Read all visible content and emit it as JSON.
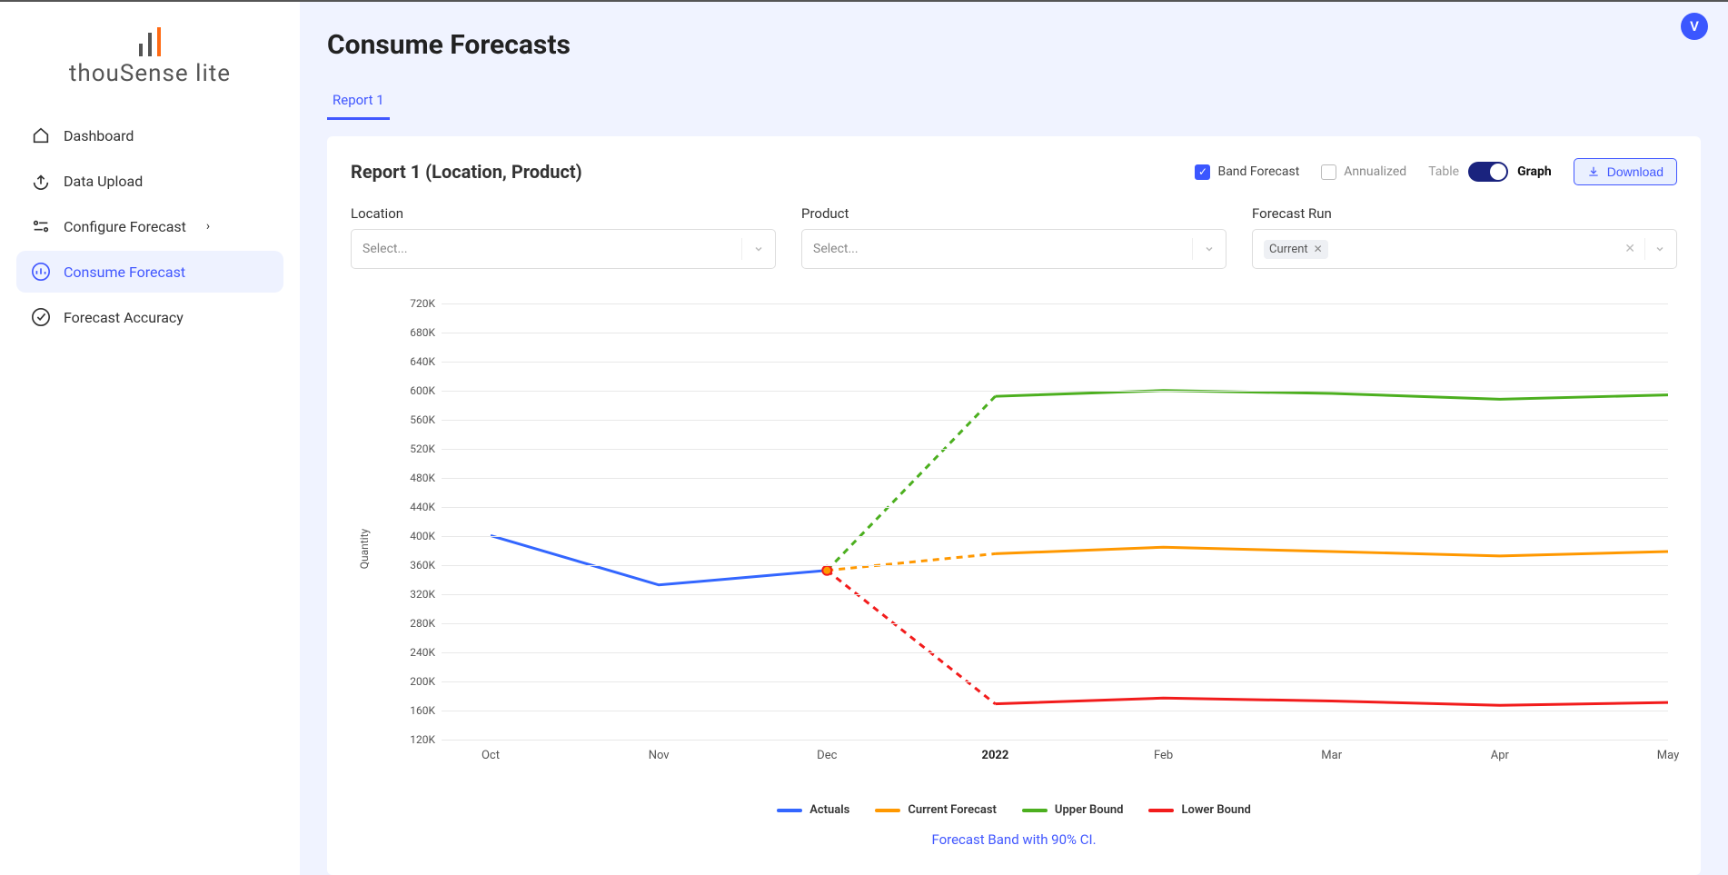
{
  "brand": {
    "name": "thouSense lite"
  },
  "avatar": {
    "initial": "V"
  },
  "sidebar": {
    "items": [
      {
        "label": "Dashboard",
        "icon": "home-icon",
        "active": false,
        "hasChildren": false
      },
      {
        "label": "Data Upload",
        "icon": "upload-icon",
        "active": false,
        "hasChildren": false
      },
      {
        "label": "Configure Forecast",
        "icon": "sliders-icon",
        "active": false,
        "hasChildren": true
      },
      {
        "label": "Consume Forecast",
        "icon": "chart-icon",
        "active": true,
        "hasChildren": false
      },
      {
        "label": "Forecast Accuracy",
        "icon": "target-icon",
        "active": false,
        "hasChildren": false
      }
    ]
  },
  "page": {
    "title": "Consume Forecasts"
  },
  "tabs": [
    {
      "label": "Report 1",
      "active": true
    }
  ],
  "report": {
    "title": "Report 1 (Location, Product)",
    "controls": {
      "band_forecast": {
        "label": "Band Forecast",
        "checked": true
      },
      "annualized": {
        "label": "Annualized",
        "checked": false
      },
      "view_toggle": {
        "left": "Table",
        "right": "Graph",
        "value": "Graph"
      },
      "download": {
        "label": "Download"
      }
    },
    "filters": {
      "location": {
        "label": "Location",
        "placeholder": "Select..."
      },
      "product": {
        "label": "Product",
        "placeholder": "Select..."
      },
      "forecast_run": {
        "label": "Forecast Run",
        "selected": "Current"
      }
    }
  },
  "chart_data": {
    "type": "line",
    "ylabel": "Quantity",
    "xlabel": "",
    "ylim": [
      120000,
      720000
    ],
    "y_ticks": [
      "720K",
      "680K",
      "640K",
      "600K",
      "560K",
      "520K",
      "480K",
      "440K",
      "400K",
      "360K",
      "320K",
      "280K",
      "240K",
      "200K",
      "160K",
      "120K"
    ],
    "categories": [
      "Oct",
      "Nov",
      "Dec",
      "2022",
      "Feb",
      "Mar",
      "Apr",
      "May"
    ],
    "bold_category": "2022",
    "series": [
      {
        "name": "Actuals",
        "color": "#3366ff",
        "style": "solid",
        "values": [
          400000,
          332000,
          352000,
          null,
          null,
          null,
          null,
          null
        ]
      },
      {
        "name": "Current Forecast",
        "color": "#ff9800",
        "style": "dashed-then-solid",
        "values": [
          null,
          null,
          352000,
          375000,
          384000,
          378000,
          372000,
          378000
        ]
      },
      {
        "name": "Upper Bound",
        "color": "#4caf1f",
        "style": "dashed-then-solid",
        "values": [
          null,
          null,
          352000,
          592000,
          600000,
          596000,
          588000,
          594000
        ]
      },
      {
        "name": "Lower Bound",
        "color": "#f21c1c",
        "style": "dashed-then-solid",
        "values": [
          null,
          null,
          352000,
          168000,
          176000,
          172000,
          166000,
          170000
        ]
      }
    ],
    "x_left_pad_fraction": 0.04,
    "caption": "Forecast Band with 90% CI.",
    "legend": [
      {
        "label": "Actuals",
        "color": "#3366ff"
      },
      {
        "label": "Current Forecast",
        "color": "#ff9800"
      },
      {
        "label": "Upper Bound",
        "color": "#4caf1f"
      },
      {
        "label": "Lower Bound",
        "color": "#f21c1c"
      }
    ]
  }
}
